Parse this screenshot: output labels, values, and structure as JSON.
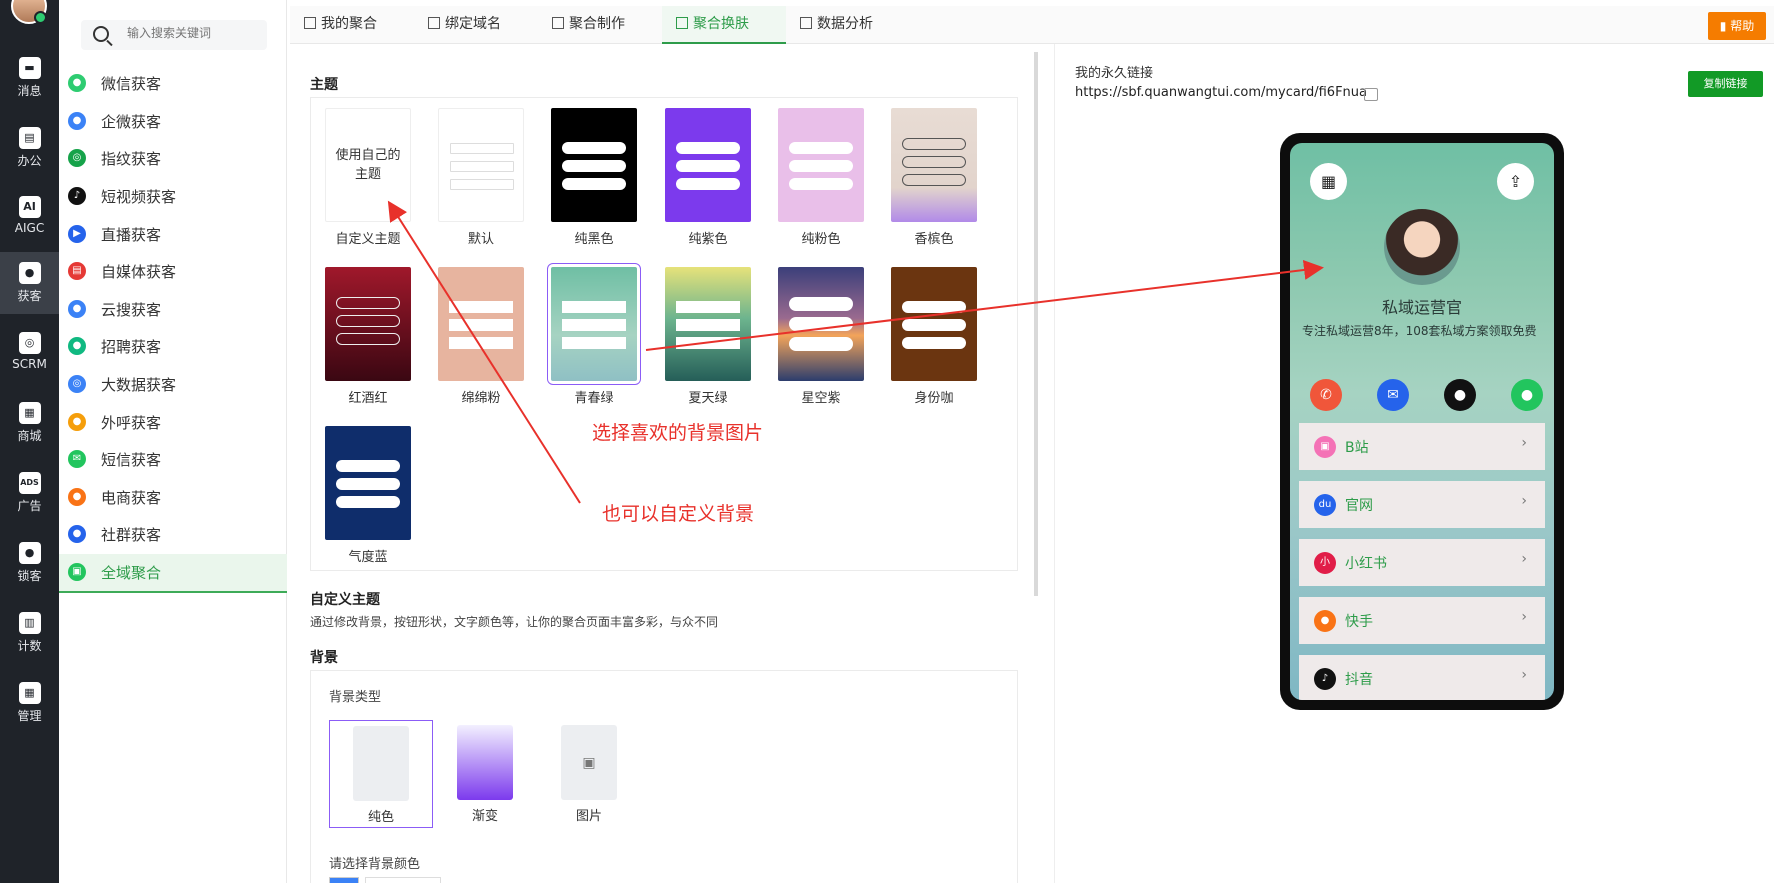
{
  "rail": {
    "items": [
      {
        "label": "消息",
        "icon": "message-icon"
      },
      {
        "label": "办公",
        "icon": "office-icon"
      },
      {
        "label": "AIGC",
        "icon": "aigc-icon"
      },
      {
        "label": "获客",
        "icon": "acquire-icon"
      },
      {
        "label": "SCRM",
        "icon": "scrm-icon"
      },
      {
        "label": "商城",
        "icon": "shop-icon"
      },
      {
        "label": "广告",
        "icon": "ads-icon"
      },
      {
        "label": "锁客",
        "icon": "lock-customer-icon"
      },
      {
        "label": "计数",
        "icon": "count-icon"
      },
      {
        "label": "管理",
        "icon": "manage-icon"
      }
    ]
  },
  "sidebar": {
    "search_placeholder": "输入搜索关键词",
    "items": [
      {
        "label": "微信获客",
        "color": "#2ecc71"
      },
      {
        "label": "企微获客",
        "color": "#3b82f6"
      },
      {
        "label": "指纹获客",
        "color": "#16a34a"
      },
      {
        "label": "短视频获客",
        "color": "#111111"
      },
      {
        "label": "直播获客",
        "color": "#2563eb"
      },
      {
        "label": "自媒体获客",
        "color": "#e53935"
      },
      {
        "label": "云搜获客",
        "color": "#3b82f6"
      },
      {
        "label": "招聘获客",
        "color": "#10b981"
      },
      {
        "label": "大数据获客",
        "color": "#3b82f6"
      },
      {
        "label": "外呼获客",
        "color": "#f59e0b"
      },
      {
        "label": "短信获客",
        "color": "#22c55e"
      },
      {
        "label": "电商获客",
        "color": "#f97316"
      },
      {
        "label": "社群获客",
        "color": "#2563eb"
      },
      {
        "label": "全域聚合",
        "color": "#22c55e"
      }
    ]
  },
  "tabs": [
    {
      "label": "我的聚合"
    },
    {
      "label": "绑定域名"
    },
    {
      "label": "聚合制作"
    },
    {
      "label": "聚合换肤"
    },
    {
      "label": "数据分析"
    }
  ],
  "help_label": "帮助",
  "main": {
    "theme_title": "主题",
    "themes": [
      {
        "name": "自定义主题",
        "card_text": "使用自己的主题"
      },
      {
        "name": "默认"
      },
      {
        "name": "纯黑色"
      },
      {
        "name": "纯紫色"
      },
      {
        "name": "纯粉色"
      },
      {
        "name": "香槟色"
      },
      {
        "name": "红酒红"
      },
      {
        "name": "绵绵粉"
      },
      {
        "name": "青春绿"
      },
      {
        "name": "夏天绿"
      },
      {
        "name": "星空紫"
      },
      {
        "name": "身份咖"
      },
      {
        "name": "气度蓝"
      }
    ],
    "custom_title": "自定义主题",
    "custom_desc": "通过修改背景，按钮形状，文字颜色等，让你的聚合页面丰富多彩，与众不同",
    "bg_title": "背景",
    "bg_type_label": "背景类型",
    "bg_types": [
      {
        "label": "纯色"
      },
      {
        "label": "渐变"
      },
      {
        "label": "图片"
      }
    ],
    "bg_color_label": "请选择背景颜色"
  },
  "annotations": {
    "pick_bg": "选择喜欢的背景图片",
    "custom_bg": "也可以自定义背景"
  },
  "right": {
    "link_label": "我的永久链接",
    "link_url": "https://sbf.quanwangtui.com/mycard/fi6Fnua",
    "copy_label": "复制链接",
    "profile_name": "私域运营官",
    "profile_desc": "专注私域运营8年，108套私域方案领取免费",
    "links": [
      {
        "label": "B站",
        "icon": "bilibili-icon",
        "color": "#f472b6"
      },
      {
        "label": "官网",
        "icon": "baidu-icon",
        "color": "#2563eb"
      },
      {
        "label": "小红书",
        "icon": "xiaohongshu-icon",
        "color": "#e11d48"
      },
      {
        "label": "快手",
        "icon": "kuaishou-icon",
        "color": "#f97316"
      },
      {
        "label": "抖音",
        "icon": "douyin-icon",
        "color": "#111111"
      }
    ]
  }
}
